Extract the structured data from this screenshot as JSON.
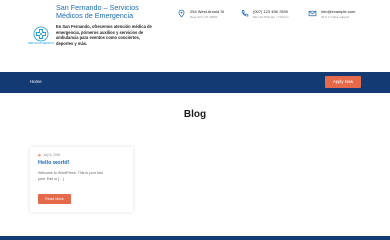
{
  "header": {
    "logo": {
      "icon": "medical-cross-logo-icon",
      "caption": "SERVICIOS MÉDICOS",
      "color": "#1a9cd2"
    },
    "site_title": "San Fernando – Servicios Médicos de Emergencia",
    "site_description": "En San Fernando, ofrecemos atención médica de emergencia, primeros auxilios y servicios de ambulancia para eventos como conciertos, deportes y más.",
    "contacts": [
      {
        "icon": "location-pin-icon",
        "line1": "254 West Arnold St",
        "line2": "New York, NY 10001"
      },
      {
        "icon": "phone-icon",
        "line1": "(007) 123 456 7890",
        "line2": "Mon-Fri 8:00 am - 7:00 pm"
      },
      {
        "icon": "mail-icon",
        "line1": "info@example.com",
        "line2": "24 X 7 online support"
      }
    ]
  },
  "nav": {
    "home_label": "Home",
    "apply_label": "Apply Now"
  },
  "main": {
    "page_title": "Blog",
    "posts": [
      {
        "date": "July 6, 2025",
        "title": "Hello world!",
        "excerpt": "Welcome to WordPress. This is your first post. Edit or […]",
        "read_more_label": "Read More"
      }
    ]
  },
  "colors": {
    "primary": "#133a73",
    "accent": "#e56a4c",
    "link": "#1e6cb3"
  }
}
